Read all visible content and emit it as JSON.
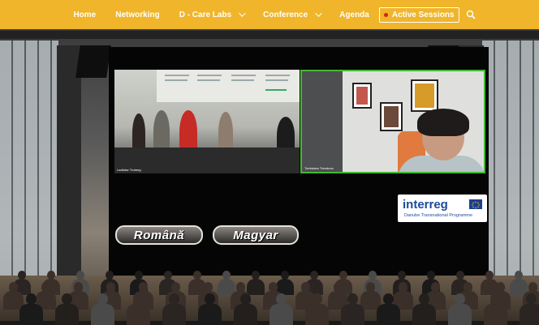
{
  "nav": {
    "items": [
      {
        "label": "Home",
        "dropdown": false
      },
      {
        "label": "Networking",
        "dropdown": false
      },
      {
        "label": "D - Care Labs",
        "dropdown": true
      },
      {
        "label": "Conference",
        "dropdown": true
      },
      {
        "label": "Agenda",
        "dropdown": false
      }
    ],
    "active_sessions": "Active Sessions",
    "search_icon": "search-icon"
  },
  "colors": {
    "nav_bg": "#f0b52a",
    "live_dot": "#d9201c",
    "active_speaker_border": "#43b832",
    "logo_blue": "#1d4a9b"
  },
  "stream": {
    "left_label": "Ladislav Troberg",
    "right_label": "Tomislava Trendova"
  },
  "logo": {
    "word": "interreg",
    "subtitle": "Danube Transnational Programme"
  },
  "languages": [
    "Română",
    "Magyar"
  ]
}
